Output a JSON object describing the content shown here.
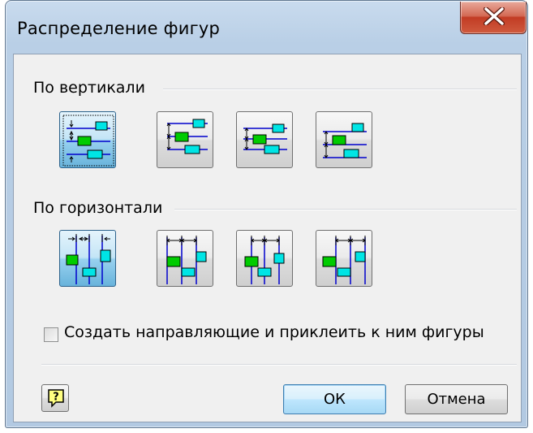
{
  "dialog": {
    "title": "Распределение фигур",
    "close_icon": "close-x-icon"
  },
  "vertical_group": {
    "label": "По вертикали",
    "options": [
      {
        "name": "vertical-distribute-option-1",
        "icon": "distribute-vertical-spacing-icon",
        "selected": true
      },
      {
        "name": "vertical-distribute-option-2",
        "icon": "distribute-vertical-top-icon",
        "selected": false
      },
      {
        "name": "vertical-distribute-option-3",
        "icon": "distribute-vertical-center-icon",
        "selected": false
      },
      {
        "name": "vertical-distribute-option-4",
        "icon": "distribute-vertical-bottom-icon",
        "selected": false
      }
    ]
  },
  "horizontal_group": {
    "label": "По горизонтали",
    "options": [
      {
        "name": "horizontal-distribute-option-1",
        "icon": "distribute-horizontal-spacing-icon",
        "selected": true
      },
      {
        "name": "horizontal-distribute-option-2",
        "icon": "distribute-horizontal-left-icon",
        "selected": false
      },
      {
        "name": "horizontal-distribute-option-3",
        "icon": "distribute-horizontal-center-icon",
        "selected": false
      },
      {
        "name": "horizontal-distribute-option-4",
        "icon": "distribute-horizontal-right-icon",
        "selected": false
      }
    ]
  },
  "guides_checkbox": {
    "label": "Создать направляющие и приклеить к ним фигуры",
    "checked": false
  },
  "footer": {
    "help_icon": "help-question-icon",
    "ok_label": "ОК",
    "cancel_label": "Отмена"
  },
  "colors": {
    "line_blue": "#0000cc",
    "shape_green": "#00cc00",
    "shape_cyan": "#00e5e5",
    "selected_blue": "#68b3db",
    "close_red": "#c23c24"
  }
}
